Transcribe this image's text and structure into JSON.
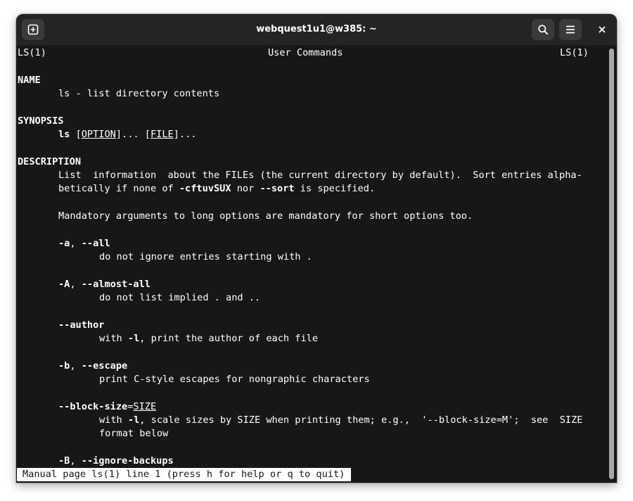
{
  "window": {
    "title": "webquest1u1@w385: ~",
    "buttons": {
      "new_tab_icon": "new-tab-icon",
      "search_icon": "search-icon",
      "menu_icon": "hamburger-menu-icon",
      "close_icon": "close-icon"
    }
  },
  "man": {
    "header": {
      "left": "LS(1)",
      "center": "User Commands",
      "right": "LS(1)"
    },
    "name_heading": "NAME",
    "name_text": "ls - list directory contents",
    "synopsis_heading": "SYNOPSIS",
    "synopsis": {
      "cmd": "ls",
      "bracket1_open": "[",
      "option": "OPTION",
      "bracket1_close": "]... ",
      "bracket2_open": "[",
      "file": "FILE",
      "bracket2_close": "]..."
    },
    "description_heading": "DESCRIPTION",
    "desc_line1": "List  information  about the FILEs (the current directory by default).  Sort entries alpha-",
    "desc_line2": {
      "a": "betically if none of ",
      "b": "-cftuvSUX",
      "c": " nor ",
      "d": "--sort",
      "e": " is specified."
    },
    "desc_mandatory": "Mandatory arguments to long options are mandatory for short options too.",
    "options": {
      "all": {
        "short": "-a",
        "sep": ", ",
        "long": "--all",
        "desc": "do not ignore entries starting with ."
      },
      "almost_all": {
        "short": "-A",
        "sep": ", ",
        "long": "--almost-all",
        "desc": "do not list implied . and .."
      },
      "author": {
        "long": "--author",
        "desc_a": "with ",
        "desc_b": "-l",
        "desc_c": ", print the author of each file"
      },
      "escape": {
        "short": "-b",
        "sep": ", ",
        "long": "--escape",
        "desc": "print C-style escapes for nongraphic characters"
      },
      "block_size": {
        "long": "--block-size",
        "eq": "=",
        "arg": "SIZE",
        "desc1_a": "with ",
        "desc1_b": "-l",
        "desc1_c": ", scale sizes by SIZE when printing them; e.g.,  '--block-size=M';  see  SIZE",
        "desc2": "format below"
      },
      "ignore_backups": {
        "short": "-B",
        "sep": ", ",
        "long": "--ignore-backups"
      }
    },
    "status": "Manual page ls(1) line 1 (press h for help or q to quit)"
  }
}
